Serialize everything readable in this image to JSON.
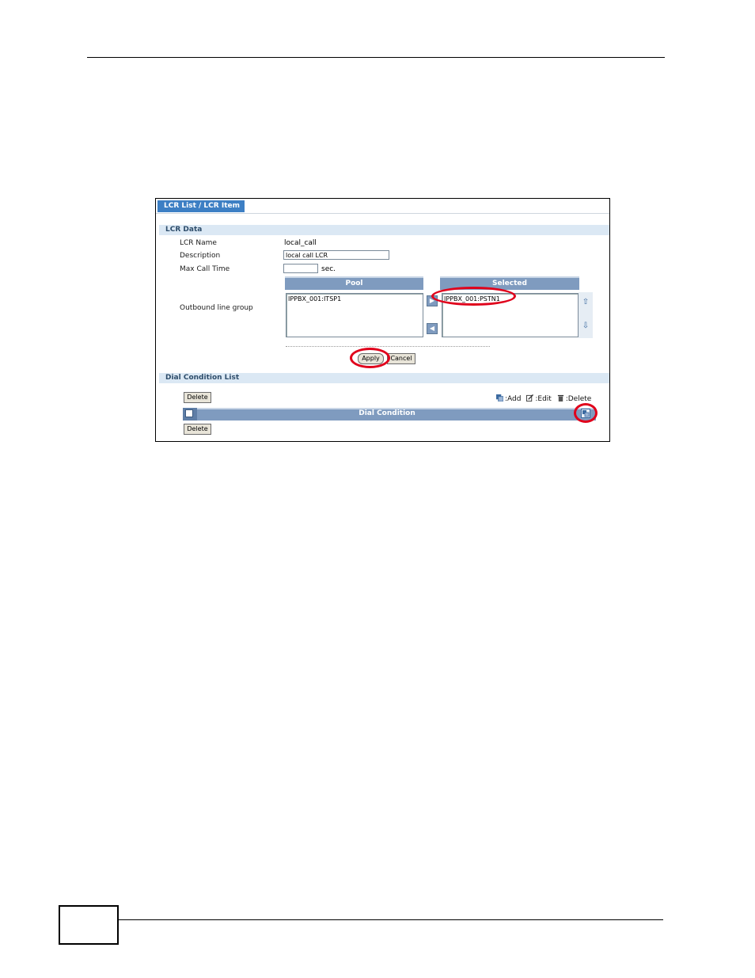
{
  "tab": {
    "label": "LCR List / LCR Item"
  },
  "lcr_data": {
    "section_title": "LCR Data",
    "name_label": "LCR Name",
    "name_value": "local_call",
    "description_label": "Description",
    "description_value": "local call LCR",
    "max_call_label": "Max Call Time",
    "max_call_value": "",
    "max_call_unit": "sec.",
    "outbound_label": "Outbound line group",
    "pool_header": "Pool",
    "selected_header": "Selected",
    "pool_items": [
      "IPPBX_001:ITSP1"
    ],
    "selected_items": [
      "IPPBX_001:PSTN1"
    ],
    "apply_label": "Apply",
    "cancel_label": "Cancel"
  },
  "dial_condition": {
    "section_title": "Dial Condition List",
    "delete_label_top": "Delete",
    "delete_label_bottom": "Delete",
    "legend_add": ":Add",
    "legend_edit": ":Edit",
    "legend_delete": ":Delete",
    "column_header": "Dial Condition"
  },
  "colors": {
    "highlight_ring": "#e0001b",
    "tab_bg": "#3d7fc4",
    "header_bg": "#7f9bbf"
  }
}
